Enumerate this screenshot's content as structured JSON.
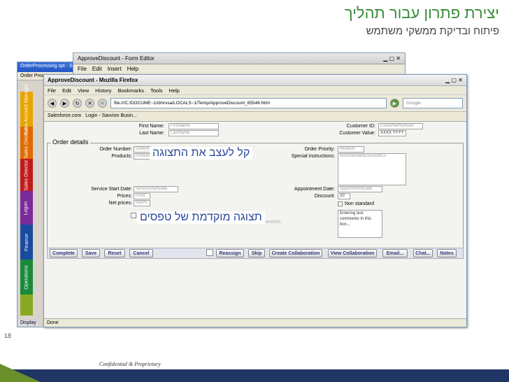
{
  "slide": {
    "title": "יצירת פתרון עבור תהליך",
    "subtitle": "פיתוח ובדיקת ממשקי משתמש",
    "page_number": "18",
    "confidential": "Confidential & Proprietary"
  },
  "back_window": {
    "title": "OrderProcessing.spt - Savvio",
    "tab": "Order Proc",
    "side_tabs": [
      {
        "label": "Sales Account Manager",
        "color": "#e8a400"
      },
      {
        "label": "Sales Director",
        "color": "#e06a00"
      },
      {
        "label": "Sales Director",
        "color": "#c01a1a"
      },
      {
        "label": "Logon",
        "color": "#7a2a9a"
      },
      {
        "label": "Finance",
        "color": "#1a4aa0"
      },
      {
        "label": "Operations",
        "color": "#1a8a3a"
      },
      {
        "label": "",
        "color": "#88aa22"
      }
    ],
    "status": "Display"
  },
  "form_editor": {
    "title": "ApproveDiscount - Form Editor",
    "menu": [
      "File",
      "Edit",
      "Insert",
      "Help"
    ]
  },
  "firefox": {
    "title": "ApproveDiscount - Mozilla Firefox",
    "menu": [
      "File",
      "Edit",
      "View",
      "History",
      "Bookmarks",
      "Tools",
      "Help"
    ],
    "address": "file:///C:/DOCUME~1/dmrvsa/LOCALS~1/Temp/ApproveDiscount_65546.html",
    "search_placeholder": "Google",
    "bookmarks": [
      "Salesforce.com",
      "Login - Savvion Busin..."
    ],
    "status": "Done"
  },
  "form": {
    "first_name_label": "First Name:",
    "first_name_value": "FirstName",
    "last_name_label": "Last Name:",
    "last_name_value": "LastName",
    "customer_id_label": "Customer ID:",
    "customer_id_value": "CustomerNotNum",
    "customer_value_label": "Customer Value:",
    "customer_value_value": "XXXX YYYY",
    "order_details_legend": "Order details",
    "order_number_label": "Order Number:",
    "order_number_value": "OrderR",
    "products_label": "Products:",
    "products_value": "Product",
    "order_priority_label": "Order Priority:",
    "order_priority_value": "Medium",
    "special_instructions_label": "Special instructions:",
    "special_instructions_value": "NonStandardDiscountCo",
    "service_start_label": "Service Start Date:",
    "service_start_value": "ServiceStartDate",
    "appointment_label": "Appointment Date:",
    "appointment_value": "AppointmentDate",
    "prices_label": "Prices:",
    "prices_value": "Price",
    "discount_label": "Discount:",
    "discount_value": "20",
    "net_prices_label": "Net prices:",
    "net_prices_value": "NetPri",
    "non_standard_label": "Non standard",
    "comments_label": "Comments:",
    "comments_value": "Entering test comments in this box..."
  },
  "buttons": [
    "Complete",
    "Save",
    "Reset",
    "Cancel",
    "Reassign",
    "Skip",
    "Create Collaboration",
    "View Collaboration",
    "Email...",
    "Chat...",
    "Notes"
  ],
  "overlays": {
    "easy_design": "קל לעצב את התצוגה",
    "form_preview": "תצוגה מוקדמת של טפסים"
  }
}
